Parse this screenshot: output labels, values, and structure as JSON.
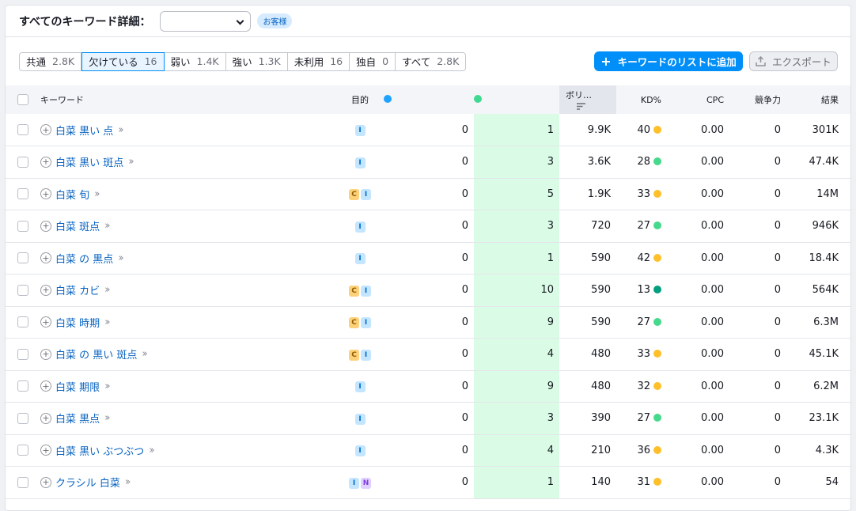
{
  "header": {
    "title": "すべてのキーワード詳細：",
    "dropdown_value": "",
    "badge": "お客様"
  },
  "filters": [
    {
      "label": "共通",
      "count": "2.8K",
      "active": false
    },
    {
      "label": "欠けている",
      "count": "16",
      "active": true
    },
    {
      "label": "弱い",
      "count": "1.4K",
      "active": false
    },
    {
      "label": "強い",
      "count": "1.3K",
      "active": false
    },
    {
      "label": "未利用",
      "count": "16",
      "active": false
    },
    {
      "label": "独自",
      "count": "0",
      "active": false
    },
    {
      "label": "すべて",
      "count": "2.8K",
      "active": false
    }
  ],
  "buttons": {
    "add": "キーワードのリストに追加",
    "add_icon": "+",
    "export": "エクスポート"
  },
  "columns": {
    "keyword": "キーワード",
    "intent": "目的",
    "volume": "ボリ…",
    "kd": "KD%",
    "cpc": "CPC",
    "competition": "競争力",
    "results": "結果"
  },
  "colors": {
    "domain1": "#1ea3ff",
    "domain2": "#3fd992",
    "kd_yellow": "#ffbf29",
    "kd_green": "#45d98b",
    "kd_darkgreen": "#009f81"
  },
  "rows": [
    {
      "keyword": "白菜 黒い 点",
      "intents": [
        "I"
      ],
      "d1": "0",
      "d2": "1",
      "volume": "9.9K",
      "kd": "40",
      "kd_color": "#ffbf29",
      "cpc": "0.00",
      "comp": "0",
      "results": "301K"
    },
    {
      "keyword": "白菜 黒い 斑点",
      "intents": [
        "I"
      ],
      "d1": "0",
      "d2": "3",
      "volume": "3.6K",
      "kd": "28",
      "kd_color": "#45d98b",
      "cpc": "0.00",
      "comp": "0",
      "results": "47.4K"
    },
    {
      "keyword": "白菜 旬",
      "intents": [
        "C",
        "I"
      ],
      "d1": "0",
      "d2": "5",
      "volume": "1.9K",
      "kd": "33",
      "kd_color": "#ffbf29",
      "cpc": "0.00",
      "comp": "0",
      "results": "14M"
    },
    {
      "keyword": "白菜 斑点",
      "intents": [
        "I"
      ],
      "d1": "0",
      "d2": "3",
      "volume": "720",
      "kd": "27",
      "kd_color": "#45d98b",
      "cpc": "0.00",
      "comp": "0",
      "results": "946K"
    },
    {
      "keyword": "白菜 の 黒点",
      "intents": [
        "I"
      ],
      "d1": "0",
      "d2": "1",
      "volume": "590",
      "kd": "42",
      "kd_color": "#ffbf29",
      "cpc": "0.00",
      "comp": "0",
      "results": "18.4K"
    },
    {
      "keyword": "白菜 カビ",
      "intents": [
        "C",
        "I"
      ],
      "d1": "0",
      "d2": "10",
      "volume": "590",
      "kd": "13",
      "kd_color": "#009f81",
      "cpc": "0.00",
      "comp": "0",
      "results": "564K"
    },
    {
      "keyword": "白菜 時期",
      "intents": [
        "C",
        "I"
      ],
      "d1": "0",
      "d2": "9",
      "volume": "590",
      "kd": "27",
      "kd_color": "#45d98b",
      "cpc": "0.00",
      "comp": "0",
      "results": "6.3M"
    },
    {
      "keyword": "白菜 の 黒い 斑点",
      "intents": [
        "C",
        "I"
      ],
      "d1": "0",
      "d2": "4",
      "volume": "480",
      "kd": "33",
      "kd_color": "#ffbf29",
      "cpc": "0.00",
      "comp": "0",
      "results": "45.1K"
    },
    {
      "keyword": "白菜 期限",
      "intents": [
        "I"
      ],
      "d1": "0",
      "d2": "9",
      "volume": "480",
      "kd": "32",
      "kd_color": "#ffbf29",
      "cpc": "0.00",
      "comp": "0",
      "results": "6.2M"
    },
    {
      "keyword": "白菜 黒点",
      "intents": [
        "I"
      ],
      "d1": "0",
      "d2": "3",
      "volume": "390",
      "kd": "27",
      "kd_color": "#45d98b",
      "cpc": "0.00",
      "comp": "0",
      "results": "23.1K"
    },
    {
      "keyword": "白菜 黒い ぶつぶつ",
      "intents": [
        "I"
      ],
      "d1": "0",
      "d2": "4",
      "volume": "210",
      "kd": "36",
      "kd_color": "#ffbf29",
      "cpc": "0.00",
      "comp": "0",
      "results": "4.3K"
    },
    {
      "keyword": "クラシル 白菜",
      "intents": [
        "I",
        "N"
      ],
      "d1": "0",
      "d2": "1",
      "volume": "140",
      "kd": "31",
      "kd_color": "#ffbf29",
      "cpc": "0.00",
      "comp": "0",
      "results": "54"
    }
  ]
}
